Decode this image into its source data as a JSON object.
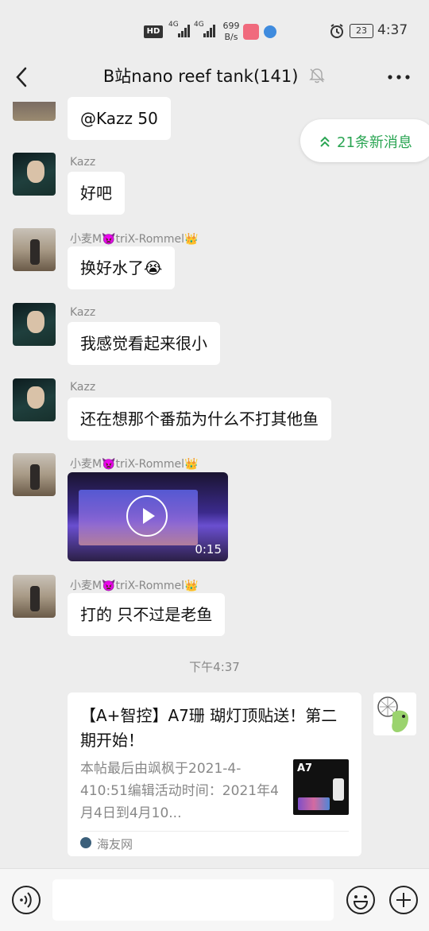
{
  "status_bar": {
    "hd": "HD",
    "net1": "4G",
    "net2": "4G",
    "speed_value": "699",
    "speed_unit": "B/s",
    "battery": "23",
    "time": "4:37"
  },
  "header": {
    "title": "B站nano reef tank(141)"
  },
  "new_messages": {
    "label": "21条新消息"
  },
  "messages": [
    {
      "sender": "",
      "text": "@Kazz 50"
    },
    {
      "sender": "Kazz",
      "text": "好吧"
    },
    {
      "sender": "小麦M👿triX-Rommel👑",
      "text": "换好水了😭"
    },
    {
      "sender": "Kazz",
      "text": "我感觉看起来很小"
    },
    {
      "sender": "Kazz",
      "text": "还在想那个番茄为什么不打其他鱼"
    },
    {
      "sender": "小麦M👿triX-Rommel👑",
      "video_duration": "0:15"
    },
    {
      "sender": "小麦M👿triX-Rommel👑",
      "text": "打的 只不过是老鱼"
    }
  ],
  "time_separator": "下午4:37",
  "link_card": {
    "title": "【A+智控】A7珊 瑚灯顶贴送！第二期开始！",
    "desc": "本帖最后由飒枫于2021-4-410:51编辑活动时间：2021年4月4日到4月10...",
    "thumb_label": "A7",
    "source": "海友网"
  },
  "colors": {
    "accent_green": "#2aa553",
    "background": "#ededed"
  }
}
